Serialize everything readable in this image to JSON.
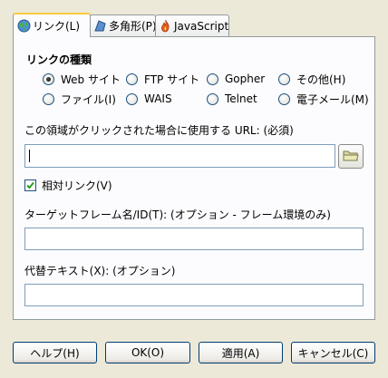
{
  "tabs": [
    {
      "label": "リンク(L)",
      "icon": "globe-icon",
      "active": true
    },
    {
      "label": "多角形(P)",
      "icon": "polygon-icon",
      "active": false
    },
    {
      "label": "JavaScript",
      "icon": "javascript-icon",
      "active": false
    }
  ],
  "link_type": {
    "title": "リンクの種類",
    "options": [
      {
        "label": "Web サイト",
        "checked": true
      },
      {
        "label": "FTP サイト",
        "checked": false
      },
      {
        "label": "Gopher",
        "checked": false
      },
      {
        "label": "その他(H)",
        "checked": false
      },
      {
        "label": "ファイル(I)",
        "checked": false
      },
      {
        "label": "WAIS",
        "checked": false
      },
      {
        "label": "Telnet",
        "checked": false
      },
      {
        "label": "電子メール(M)",
        "checked": false
      }
    ]
  },
  "url_field": {
    "label": "この領域がクリックされた場合に使用する URL: (必須)",
    "value": ""
  },
  "relative_link": {
    "label": "相対リンク(V)",
    "checked": true
  },
  "target_field": {
    "label": "ターゲットフレーム名/ID(T): (オプション - フレーム環境のみ)",
    "value": ""
  },
  "alt_field": {
    "label": "代替テキスト(X): (オプション)",
    "value": ""
  },
  "buttons": {
    "help": "ヘルプ(H)",
    "ok": "OK(O)",
    "apply": "適用(A)",
    "cancel": "キャンセル(C)"
  },
  "colors": {
    "accent_tab": "#ffc83c",
    "panel": "#fcfcfe",
    "dialog": "#ece9d8",
    "border": "#919b9c"
  }
}
